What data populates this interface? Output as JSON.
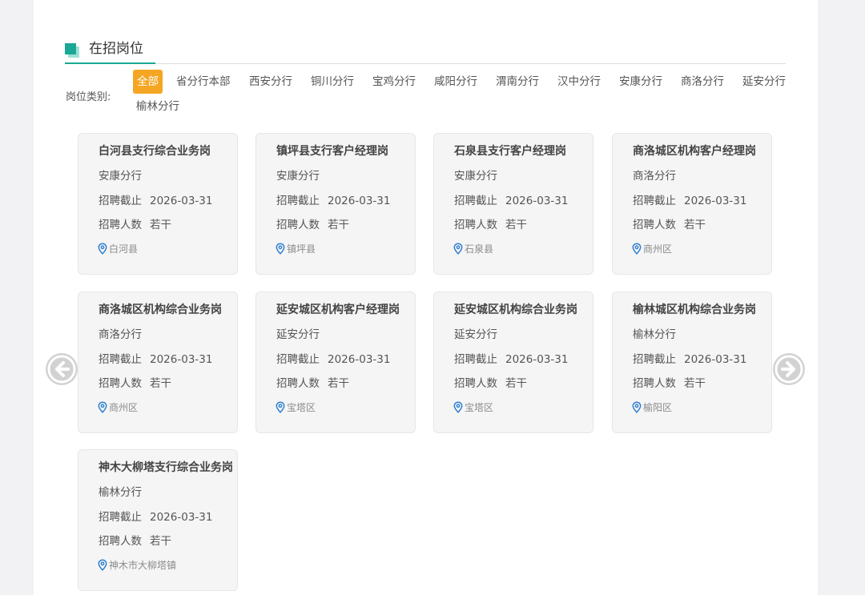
{
  "section": {
    "title": "在招岗位"
  },
  "filter": {
    "label": "岗位类别:",
    "options": [
      "全部",
      "省分行本部",
      "西安分行",
      "铜川分行",
      "宝鸡分行",
      "咸阳分行",
      "渭南分行",
      "汉中分行",
      "安康分行",
      "商洛分行",
      "延安分行",
      "榆林分行"
    ],
    "selected": "全部"
  },
  "jobs": [
    {
      "title": "白河县支行综合业务岗",
      "branch": "安康分行",
      "deadline_label": "招聘截止",
      "deadline": "2026-03-31",
      "count_label": "招聘人数",
      "count": "若干",
      "location": "白河县"
    },
    {
      "title": "镇坪县支行客户经理岗",
      "branch": "安康分行",
      "deadline_label": "招聘截止",
      "deadline": "2026-03-31",
      "count_label": "招聘人数",
      "count": "若干",
      "location": "镇坪县"
    },
    {
      "title": "石泉县支行客户经理岗",
      "branch": "安康分行",
      "deadline_label": "招聘截止",
      "deadline": "2026-03-31",
      "count_label": "招聘人数",
      "count": "若干",
      "location": "石泉县"
    },
    {
      "title": "商洛城区机构客户经理岗",
      "branch": "商洛分行",
      "deadline_label": "招聘截止",
      "deadline": "2026-03-31",
      "count_label": "招聘人数",
      "count": "若干",
      "location": "商州区"
    },
    {
      "title": "商洛城区机构综合业务岗",
      "branch": "商洛分行",
      "deadline_label": "招聘截止",
      "deadline": "2026-03-31",
      "count_label": "招聘人数",
      "count": "若干",
      "location": "商州区"
    },
    {
      "title": "延安城区机构客户经理岗",
      "branch": "延安分行",
      "deadline_label": "招聘截止",
      "deadline": "2026-03-31",
      "count_label": "招聘人数",
      "count": "若干",
      "location": "宝塔区"
    },
    {
      "title": "延安城区机构综合业务岗",
      "branch": "延安分行",
      "deadline_label": "招聘截止",
      "deadline": "2026-03-31",
      "count_label": "招聘人数",
      "count": "若干",
      "location": "宝塔区"
    },
    {
      "title": "榆林城区机构综合业务岗",
      "branch": "榆林分行",
      "deadline_label": "招聘截止",
      "deadline": "2026-03-31",
      "count_label": "招聘人数",
      "count": "若干",
      "location": "榆阳区"
    },
    {
      "title": "神木大柳塔支行综合业务岗",
      "branch": "榆林分行",
      "deadline_label": "招聘截止",
      "deadline": "2026-03-31",
      "count_label": "招聘人数",
      "count": "若干",
      "location": "神木市大柳塔镇"
    }
  ],
  "icons": {
    "prev": "chevron-left-circle-icon",
    "next": "chevron-right-circle-icon",
    "location": "location-pin-icon"
  },
  "colors": {
    "accent": "#1aa894",
    "active_chip": "#f5a623",
    "pin": "#2f7fd1"
  }
}
